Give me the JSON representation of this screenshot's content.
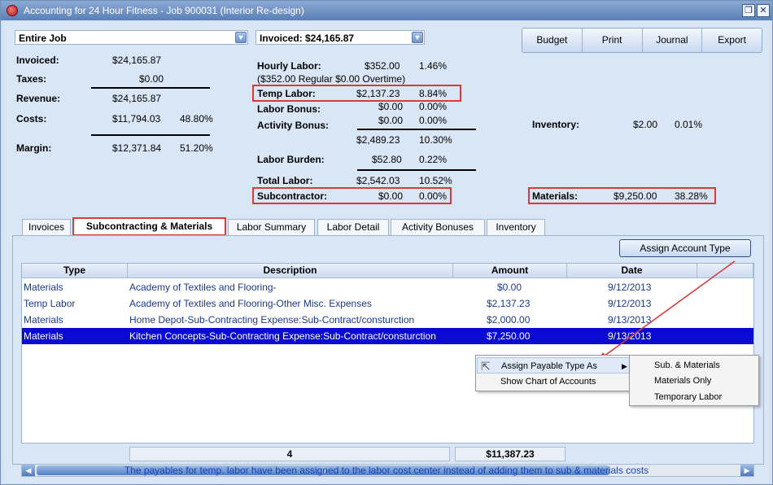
{
  "window": {
    "title": "Accounting for 24 Hour Fitness - Job 900031 (Interior Re-design)",
    "restore_glyph": "❐",
    "close_glyph": "✕",
    "icon": "app-globe-icon"
  },
  "filters": {
    "job_scope": "Entire Job",
    "invoiced_filter": "Invoiced: $24,165.87"
  },
  "toolbar": {
    "budget": "Budget",
    "print": "Print",
    "journal": "Journal",
    "export": "Export"
  },
  "summary": {
    "invoiced_label": "Invoiced:",
    "invoiced_value": "$24,165.87",
    "taxes_label": "Taxes:",
    "taxes_value": "$0.00",
    "revenue_label": "Revenue:",
    "revenue_value": "$24,165.87",
    "costs_label": "Costs:",
    "costs_value": "$11,794.03",
    "costs_pct": "48.80%",
    "margin_label": "Margin:",
    "margin_value": "$12,371.84",
    "margin_pct": "51.20%"
  },
  "labor": {
    "hourly_label": "Hourly Labor:",
    "hourly_value": "$352.00",
    "hourly_pct": "1.46%",
    "hourly_breakdown": "($352.00 Regular $0.00 Overtime)",
    "temp_label": "Temp Labor:",
    "temp_value": "$2,137.23",
    "temp_pct": "8.84%",
    "bonus_label": "Labor Bonus:",
    "bonus_value": "$0.00",
    "bonus_pct": "0.00%",
    "activity_label": "Activity Bonus:",
    "activity_value": "$0.00",
    "activity_pct": "0.00%",
    "subtotal_value": "$2,489.23",
    "subtotal_pct": "10.30%",
    "burden_label": "Labor Burden:",
    "burden_value": "$52.80",
    "burden_pct": "0.22%",
    "total_label": "Total Labor:",
    "total_value": "$2,542.03",
    "total_pct": "10.52%",
    "sub_label": "Subcontractor:",
    "sub_value": "$0.00",
    "sub_pct": "0.00%"
  },
  "other": {
    "inventory_label": "Inventory:",
    "inventory_value": "$2.00",
    "inventory_pct": "0.01%",
    "materials_label": "Materials:",
    "materials_value": "$9,250.00",
    "materials_pct": "38.28%"
  },
  "tabs": [
    "Invoices",
    "Subcontracting & Materials",
    "Labor Summary",
    "Labor Detail",
    "Activity Bonuses",
    "Inventory"
  ],
  "panel": {
    "assign_button": "Assign Account Type",
    "columns": [
      "Type",
      "Description",
      "Amount",
      "Date"
    ],
    "rows": [
      {
        "type": "Materials",
        "description": "Academy of Textiles and Flooring-",
        "amount": "$0.00",
        "date": "9/12/2013"
      },
      {
        "type": "Temp Labor",
        "description": "Academy of Textiles and Flooring-Other Misc. Expenses",
        "amount": "$2,137.23",
        "date": "9/12/2013"
      },
      {
        "type": "Materials",
        "description": "Home Depot-Sub-Contracting Expense:Sub-Contract/consturction",
        "amount": "$2,000.00",
        "date": "9/13/2013"
      },
      {
        "type": "Materials",
        "description": "Kitchen Concepts-Sub-Contracting Expense:Sub-Contract/consturction",
        "amount": "$7,250.00",
        "date": "9/13/2013"
      }
    ],
    "count": "4",
    "total": "$11,387.23"
  },
  "context_menu": {
    "items": [
      "Assign Payable Type As",
      "Show Chart of Accounts"
    ],
    "submenu": [
      "Sub. & Materials",
      "Materials Only",
      "Temporary Labor"
    ]
  },
  "status_text": "The payables for temp. labor have been assigned to the labor cost center instead of adding them to sub & materials costs",
  "colors": {
    "highlight_red": "#d93a3a",
    "selection_blue": "#0a0ad4",
    "status_blue": "#1b3fb0"
  }
}
